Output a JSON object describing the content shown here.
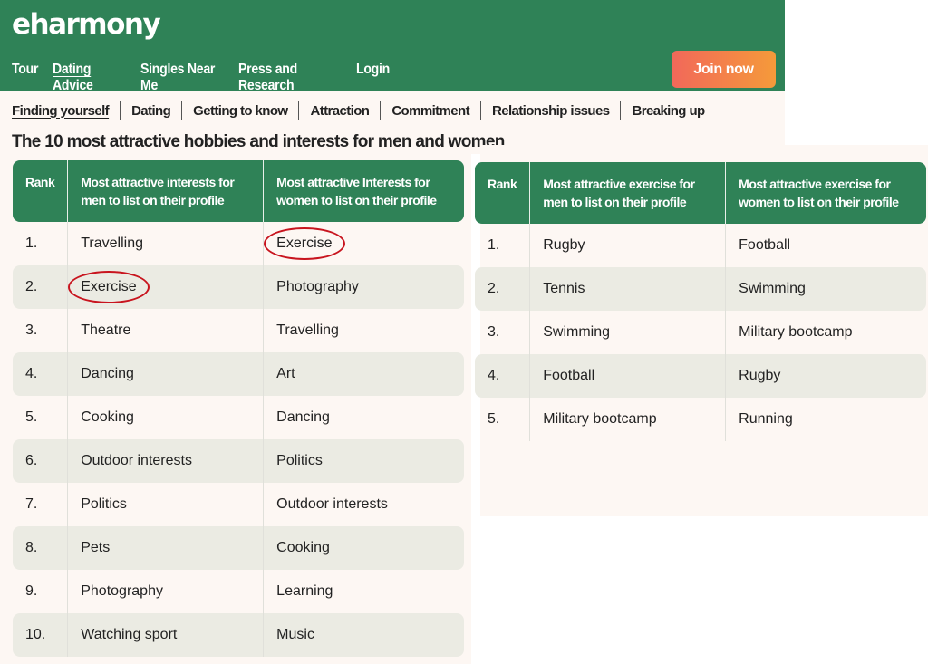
{
  "brand": {
    "logo_text": "eharmony"
  },
  "nav": {
    "items": [
      "Tour",
      "Dating Advice",
      "Singles Near Me",
      "Press and Research",
      "Login"
    ],
    "active": "Dating Advice",
    "join_label": "Join now"
  },
  "subnav": {
    "items": [
      "Finding yourself",
      "Dating",
      "Getting to know",
      "Attraction",
      "Commitment",
      "Relationship issues",
      "Breaking up"
    ],
    "active": "Finding yourself"
  },
  "page": {
    "title": "The 10 most attractive hobbies and interests for men and women"
  },
  "interests_table": {
    "headers": [
      "Rank",
      "Most attractive interests for men to list on their profile",
      "Most attractive Interests for women to list on their profile"
    ],
    "rows": [
      [
        "1.",
        "Travelling",
        "Exercise"
      ],
      [
        "2.",
        "Exercise",
        "Photography"
      ],
      [
        "3.",
        "Theatre",
        "Travelling"
      ],
      [
        "4.",
        "Dancing",
        "Art"
      ],
      [
        "5.",
        "Cooking",
        "Dancing"
      ],
      [
        "6.",
        "Outdoor interests",
        "Politics"
      ],
      [
        "7.",
        "Politics",
        "Outdoor interests"
      ],
      [
        "8.",
        "Pets",
        "Cooking"
      ],
      [
        "9.",
        "Photography",
        "Learning"
      ],
      [
        "10.",
        "Watching sport",
        "Music"
      ]
    ],
    "circled_cells": [
      "1-women",
      "2-men"
    ]
  },
  "exercise_table": {
    "headers": [
      "Rank",
      "Most attractive exercise for men to list on their profile",
      "Most attractive exercise for women to list on their profile"
    ],
    "rows": [
      [
        "1.",
        "Rugby",
        "Football"
      ],
      [
        "2.",
        "Tennis",
        "Swimming"
      ],
      [
        "3.",
        "Swimming",
        "Military bootcamp"
      ],
      [
        "4.",
        "Football",
        "Rugby"
      ],
      [
        "5.",
        "Military bootcamp",
        "Running"
      ]
    ]
  },
  "colors": {
    "brand_green": "#2f8257",
    "join_gradient_start": "#f2685a",
    "join_gradient_end": "#f59a3a",
    "row_stripe": "#ebebe3",
    "page_bg": "#fdf7f3",
    "annotation_red": "#c8141e"
  }
}
